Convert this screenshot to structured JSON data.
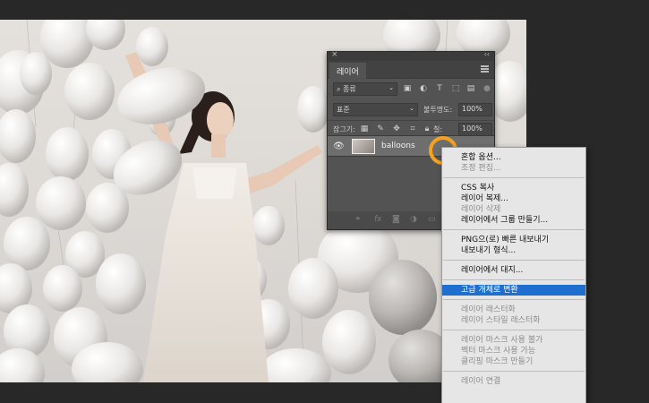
{
  "layers_panel": {
    "tab_label": "레이어",
    "filter": {
      "value": "종류",
      "icons": [
        "image-filter-icon",
        "adjustment-filter-icon",
        "type-filter-icon",
        "shape-filter-icon",
        "smart-object-filter-icon"
      ]
    },
    "blend_mode": "표준",
    "opacity_label": "불투명도:",
    "opacity_value": "100%",
    "lock_label": "잠그기:",
    "fill_label": "칠:",
    "fill_value": "100%",
    "layer": {
      "name": "balloons",
      "visible": true
    }
  },
  "context_menu": {
    "groups": [
      [
        {
          "label": "혼합 옵션...",
          "enabled": true
        },
        {
          "label": "조정 편집...",
          "enabled": false
        }
      ],
      [
        {
          "label": "CSS 복사",
          "enabled": true
        },
        {
          "label": "레이어 복제...",
          "enabled": true
        },
        {
          "label": "레이어 삭제",
          "enabled": false
        },
        {
          "label": "레이어에서 그룹 만들기...",
          "enabled": true
        }
      ],
      [
        {
          "label": "PNG으(로) 빠른 내보내기",
          "enabled": true
        },
        {
          "label": "내보내기 형식...",
          "enabled": true
        }
      ],
      [
        {
          "label": "레이어에서 대지...",
          "enabled": true
        }
      ],
      [
        {
          "label": "고급 개체로 변환",
          "enabled": true,
          "highlighted": true
        }
      ],
      [
        {
          "label": "레이어 래스터화",
          "enabled": false
        },
        {
          "label": "레이어 스타일 래스터화",
          "enabled": false
        }
      ],
      [
        {
          "label": "레이어 마스크 사용 불가",
          "enabled": false
        },
        {
          "label": "벡터 마스크 사용 가능",
          "enabled": false
        },
        {
          "label": "클리핑 마스크 만들기",
          "enabled": false
        }
      ],
      [
        {
          "label": "레이어 연결",
          "enabled": false
        }
      ]
    ]
  },
  "colors": {
    "highlight": "#1f6fd1",
    "cursor_ring": "#f5a21f",
    "panel_bg": "#535353"
  }
}
